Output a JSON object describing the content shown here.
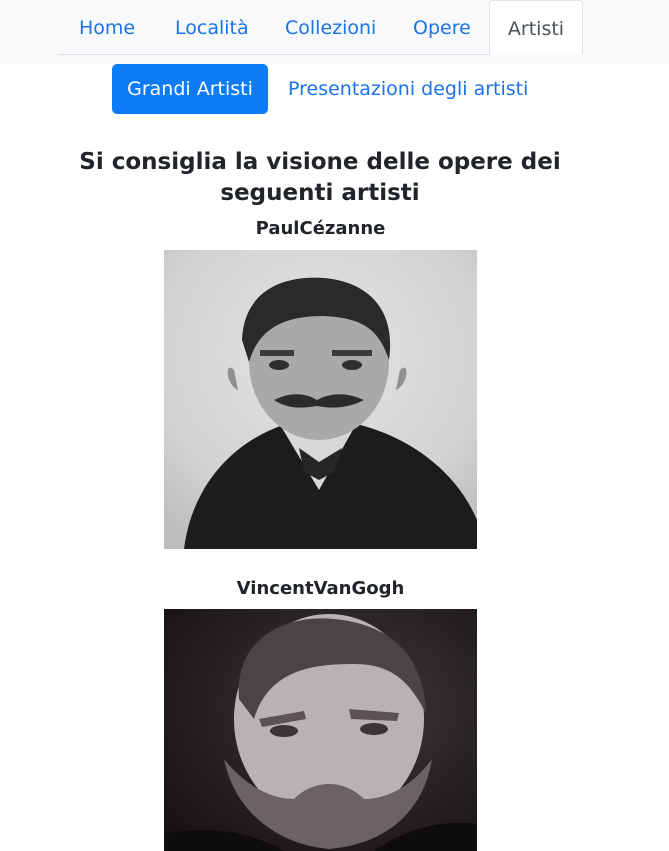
{
  "nav": {
    "tabs": [
      {
        "label": "Home"
      },
      {
        "label": "Località"
      },
      {
        "label": "Collezioni"
      },
      {
        "label": "Opere"
      },
      {
        "label": "Artisti"
      }
    ],
    "active_tab": "Artisti"
  },
  "subnav": {
    "items": [
      {
        "label": "Grandi Artisti"
      },
      {
        "label": "Presentazioni degli artisti"
      }
    ],
    "active_item": "Grandi Artisti"
  },
  "main": {
    "heading": "Si consiglia la visione delle opere dei seguenti artisti",
    "artists": [
      {
        "name": "PaulCézanne"
      },
      {
        "name": "VincentVanGogh"
      }
    ]
  },
  "colors": {
    "link": "#1a73e8",
    "primary": "#0d7bf7",
    "navbar_bg": "#f8f9fa"
  }
}
